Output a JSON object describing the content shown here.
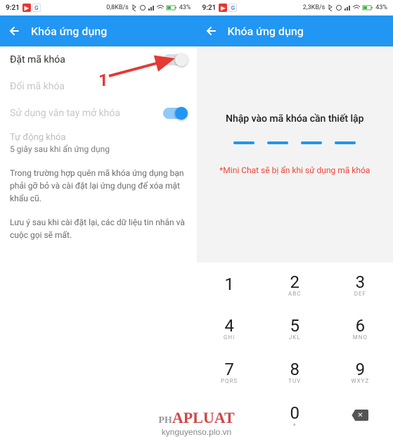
{
  "statusbar": {
    "time": "9:21",
    "speed_left": "0,8KB/s",
    "speed_right": "2,3KB/s",
    "battery": "43%"
  },
  "header": {
    "title": "Khóa ứng dụng"
  },
  "left": {
    "set_lock": "Đặt mã khóa",
    "change_lock": "Đổi mã khóa",
    "fingerprint": "Sử dụng vân tay mở khóa",
    "auto_lock_label": "Tự động khóa",
    "auto_lock_sub": "5 giây sau khi ẩn ứng dụng",
    "note1": "Trong trường hợp quên mã khóa ứng dụng bạn phải gỡ bỏ và cài đặt lại ứng dụng để xóa mật khẩu cũ.",
    "note2": "Lưu ý sau khi cài đặt lại, các dữ liệu tin nhắn và cuộc gọi sẽ mất.",
    "annotation": "1"
  },
  "right": {
    "title": "Nhập vào mã khóa cần thiết lập",
    "warning": "*Mini Chat sẽ bị ẩn khi sử dụng mã khóa"
  },
  "keypad": {
    "k1": "1",
    "k2": "2",
    "k3": "3",
    "k4": "4",
    "k5": "5",
    "k6": "6",
    "k7": "7",
    "k8": "8",
    "k9": "9",
    "k0": "0",
    "l2": "ABC",
    "l3": "DEF",
    "l4": "GHI",
    "l5": "JKL",
    "l6": "MNO",
    "l7": "PQRS",
    "l8": "TUV",
    "l9": "WXYZ",
    "l0": "+"
  },
  "watermark": {
    "logo_prefix": "PH",
    "logo_main": "APLUAT",
    "url": "kynguyenso.plo.vn"
  }
}
